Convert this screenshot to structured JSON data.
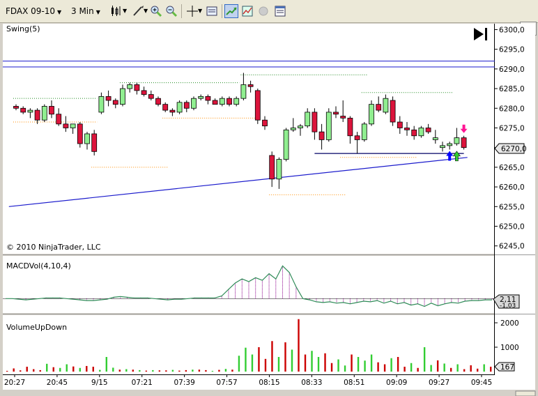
{
  "toolbar": {
    "instrument": "FDAX 09-10",
    "interval": "3 Min"
  },
  "colors": {
    "up": "#90ee90",
    "down": "#dc143c",
    "macd": "#2e8b57",
    "hist": "#8b008b",
    "vol_up": "#32cd32",
    "vol_down": "#cc0000",
    "trend": "#1a1acc",
    "swing_high": "#228b22",
    "swing_low": "#ff8c00"
  },
  "chart_data": [
    {
      "type": "candlestick",
      "title": "Swing(5)",
      "copyright": "© 2010 NinjaTrader, LLC",
      "ylim": [
        6243.0,
        6301.5
      ],
      "y_ticks": [
        "6300,0",
        "6295,0",
        "6290,0",
        "6285,0",
        "6280,0",
        "6275,0",
        "6270,0",
        "6265,0",
        "6260,0",
        "6255,0",
        "6250,0",
        "6245,0"
      ],
      "x_ticks": [
        "20:27",
        "20:45",
        "9/15",
        "07:21",
        "07:39",
        "07:57",
        "08:15",
        "08:33",
        "08:51",
        "09:09",
        "09:27",
        "09:45"
      ],
      "last_price": "6270,0",
      "ohlc": [
        [
          6280.5,
          6281.0,
          6279.5,
          6280.0
        ],
        [
          6280.0,
          6280.5,
          6278.5,
          6279.0
        ],
        [
          6279.0,
          6280.0,
          6277.5,
          6279.5
        ],
        [
          6279.5,
          6280.0,
          6276.0,
          6277.0
        ],
        [
          6277.0,
          6281.0,
          6276.5,
          6280.5
        ],
        [
          6280.5,
          6282.0,
          6277.5,
          6278.5
        ],
        [
          6278.5,
          6280.0,
          6275.5,
          6276.0
        ],
        [
          6276.0,
          6278.0,
          6274.0,
          6275.0
        ],
        [
          6275.0,
          6276.0,
          6273.5,
          6276.0
        ],
        [
          6276.0,
          6276.5,
          6270.0,
          6271.0
        ],
        [
          6271.0,
          6274.0,
          6269.5,
          6273.5
        ],
        [
          6273.5,
          6274.5,
          6268.0,
          6269.0
        ],
        [
          6279.0,
          6284.0,
          6278.5,
          6283.0
        ],
        [
          6283.0,
          6284.5,
          6280.5,
          6282.0
        ],
        [
          6282.0,
          6282.5,
          6280.0,
          6281.0
        ],
        [
          6281.0,
          6286.0,
          6280.5,
          6285.0
        ],
        [
          6285.0,
          6286.5,
          6284.0,
          6286.0
        ],
        [
          6286.0,
          6286.5,
          6283.5,
          6284.5
        ],
        [
          6284.5,
          6285.5,
          6283.0,
          6283.5
        ],
        [
          6283.5,
          6284.5,
          6282.0,
          6282.5
        ],
        [
          6282.5,
          6283.0,
          6280.5,
          6281.0
        ],
        [
          6281.0,
          6281.5,
          6279.0,
          6279.5
        ],
        [
          6279.5,
          6280.0,
          6278.0,
          6279.0
        ],
        [
          6279.0,
          6282.0,
          6278.5,
          6281.5
        ],
        [
          6281.5,
          6282.0,
          6279.0,
          6280.0
        ],
        [
          6280.0,
          6283.0,
          6279.5,
          6282.5
        ],
        [
          6282.5,
          6283.5,
          6282.0,
          6283.0
        ],
        [
          6283.0,
          6283.5,
          6281.0,
          6282.0
        ],
        [
          6282.0,
          6282.5,
          6281.0,
          6281.0
        ],
        [
          6281.0,
          6283.0,
          6280.5,
          6282.5
        ],
        [
          6282.5,
          6283.0,
          6280.5,
          6281.0
        ],
        [
          6281.0,
          6283.0,
          6280.5,
          6282.5
        ],
        [
          6282.5,
          6289.0,
          6282.0,
          6286.0
        ],
        [
          6286.0,
          6287.0,
          6284.0,
          6285.5
        ],
        [
          6284.5,
          6285.0,
          6276.0,
          6277.0
        ],
        [
          6277.0,
          6278.0,
          6274.5,
          6275.5
        ],
        [
          6268.0,
          6269.0,
          6260.0,
          6262.0
        ],
        [
          6262.0,
          6267.5,
          6259.5,
          6267.0
        ],
        [
          6267.0,
          6275.0,
          6266.5,
          6274.5
        ],
        [
          6274.5,
          6277.5,
          6274.0,
          6275.0
        ],
        [
          6275.0,
          6276.0,
          6273.0,
          6275.5
        ],
        [
          6275.5,
          6280.0,
          6275.0,
          6279.0
        ],
        [
          6279.0,
          6280.0,
          6272.0,
          6274.0
        ],
        [
          6274.0,
          6276.0,
          6269.5,
          6272.0
        ],
        [
          6272.0,
          6280.0,
          6271.5,
          6279.0
        ],
        [
          6279.0,
          6280.5,
          6277.5,
          6278.5
        ],
        [
          6278.0,
          6282.0,
          6276.5,
          6277.5
        ],
        [
          6277.5,
          6278.0,
          6271.0,
          6273.0
        ],
        [
          6273.0,
          6274.0,
          6268.5,
          6272.0
        ],
        [
          6272.0,
          6276.5,
          6271.5,
          6276.0
        ],
        [
          6276.0,
          6282.0,
          6275.5,
          6281.0
        ],
        [
          6281.0,
          6283.0,
          6279.0,
          6279.5
        ],
        [
          6279.0,
          6283.5,
          6278.5,
          6282.5
        ],
        [
          6282.0,
          6283.0,
          6275.5,
          6276.5
        ],
        [
          6276.5,
          6278.0,
          6273.5,
          6275.0
        ],
        [
          6275.0,
          6276.5,
          6273.0,
          6274.5
        ],
        [
          6274.5,
          6275.5,
          6272.0,
          6273.0
        ],
        [
          6273.0,
          6275.5,
          6272.5,
          6275.0
        ],
        [
          6275.0,
          6276.0,
          6273.5,
          6274.0
        ],
        [
          6272.0,
          6274.5,
          6271.0,
          6272.5
        ],
        [
          6270.0,
          6271.5,
          6269.0,
          6270.5
        ],
        [
          6270.5,
          6271.5,
          6269.5,
          6271.0
        ],
        [
          6271.0,
          6275.0,
          6270.5,
          6272.5
        ],
        [
          6272.5,
          6273.0,
          6269.5,
          6270.0
        ]
      ],
      "swing_highs": [
        {
          "from": 0,
          "to": 11,
          "value": 6282.5
        },
        {
          "from": 15,
          "to": 31,
          "value": 6286.5
        },
        {
          "from": 32,
          "to": 49,
          "value": 6288.5
        },
        {
          "from": 49,
          "to": 61,
          "value": 6284.0
        }
      ],
      "swing_lows": [
        {
          "from": 0,
          "to": 11,
          "value": 6276.5
        },
        {
          "from": 11,
          "to": 21,
          "value": 6265.0
        },
        {
          "from": 21,
          "to": 34,
          "value": 6277.5
        },
        {
          "from": 36,
          "to": 46,
          "value": 6258.0
        },
        {
          "from": 46,
          "to": 56,
          "value": 6267.5
        }
      ],
      "horizontal_lines": [
        6292.0,
        6290.5
      ],
      "support_line": {
        "from": 42,
        "to": 63,
        "value": 6268.5
      },
      "trend_line": {
        "x1": -1,
        "y1": 6255.0,
        "x2": 63.5,
        "y2": 6267.5
      },
      "short_arrow_bar": 63,
      "long_arrow_bar": 62,
      "entry_arrow_bar": 61
    },
    {
      "type": "line",
      "title": "MACDVol(4,10,4)",
      "value_labels": [
        "2,11",
        "-1,03"
      ],
      "macd": [
        0,
        0,
        -0.5,
        -1,
        -0.5,
        0,
        0.5,
        0.5,
        0.5,
        0,
        -0.5,
        -1,
        -1.5,
        -1.5,
        -1,
        -0.5,
        1,
        1.5,
        1,
        0.5,
        0.5,
        0.5,
        0,
        -0.5,
        -1,
        -0.5,
        -0.5,
        0,
        0.5,
        0.5,
        0.5,
        0.5,
        2,
        7,
        12,
        15,
        13,
        16,
        14,
        19,
        15,
        25,
        20,
        9,
        0,
        -1,
        -2.5,
        -3,
        -2.5,
        -3.5,
        -3,
        -4,
        -3,
        -2,
        -2.5,
        -1.5,
        -3.5,
        -2,
        -4,
        -3,
        -5,
        -4,
        -6,
        -3.5,
        -5.5,
        -4,
        -3,
        -3.5,
        -2,
        -1.5,
        -1.5,
        -1,
        -1
      ],
      "ylim": [
        -10,
        30
      ]
    },
    {
      "type": "bar",
      "title": "VolumeUpDown",
      "y_ticks": [
        "2000",
        "1000"
      ],
      "last_value": "167",
      "ylim": [
        0,
        2200
      ],
      "volume": [
        [
          30,
          "down"
        ],
        [
          130,
          "down"
        ],
        [
          50,
          "down"
        ],
        [
          200,
          "down"
        ],
        [
          100,
          "down"
        ],
        [
          60,
          "down"
        ],
        [
          320,
          "up"
        ],
        [
          180,
          "down"
        ],
        [
          150,
          "up"
        ],
        [
          300,
          "up"
        ],
        [
          210,
          "down"
        ],
        [
          150,
          "up"
        ],
        [
          230,
          "down"
        ],
        [
          200,
          "down"
        ],
        [
          70,
          "up"
        ],
        [
          600,
          "up"
        ],
        [
          160,
          "up"
        ],
        [
          80,
          "down"
        ],
        [
          100,
          "up"
        ],
        [
          80,
          "down"
        ],
        [
          60,
          "up"
        ],
        [
          40,
          "down"
        ],
        [
          60,
          "up"
        ],
        [
          50,
          "down"
        ],
        [
          50,
          "down"
        ],
        [
          70,
          "up"
        ],
        [
          40,
          "down"
        ],
        [
          60,
          "down"
        ],
        [
          80,
          "up"
        ],
        [
          80,
          "down"
        ],
        [
          60,
          "down"
        ],
        [
          30,
          "up"
        ],
        [
          70,
          "down"
        ],
        [
          110,
          "up"
        ],
        [
          80,
          "down"
        ],
        [
          650,
          "up"
        ],
        [
          980,
          "up"
        ],
        [
          700,
          "up"
        ],
        [
          1000,
          "down"
        ],
        [
          520,
          "down"
        ],
        [
          1250,
          "down"
        ],
        [
          600,
          "up"
        ],
        [
          1200,
          "down"
        ],
        [
          900,
          "up"
        ],
        [
          2150,
          "down"
        ],
        [
          700,
          "down"
        ],
        [
          850,
          "up"
        ],
        [
          600,
          "up"
        ],
        [
          750,
          "down"
        ],
        [
          350,
          "down"
        ],
        [
          500,
          "up"
        ],
        [
          250,
          "up"
        ],
        [
          700,
          "down"
        ],
        [
          600,
          "up"
        ],
        [
          450,
          "up"
        ],
        [
          700,
          "up"
        ],
        [
          380,
          "down"
        ],
        [
          300,
          "down"
        ],
        [
          550,
          "up"
        ],
        [
          600,
          "down"
        ],
        [
          200,
          "down"
        ],
        [
          350,
          "up"
        ],
        [
          150,
          "down"
        ],
        [
          1000,
          "up"
        ],
        [
          270,
          "up"
        ],
        [
          460,
          "down"
        ],
        [
          330,
          "up"
        ],
        [
          150,
          "down"
        ],
        [
          300,
          "up"
        ],
        [
          100,
          "down"
        ],
        [
          260,
          "down"
        ],
        [
          120,
          "down"
        ],
        [
          300,
          "up"
        ],
        [
          200,
          "down"
        ]
      ]
    }
  ]
}
